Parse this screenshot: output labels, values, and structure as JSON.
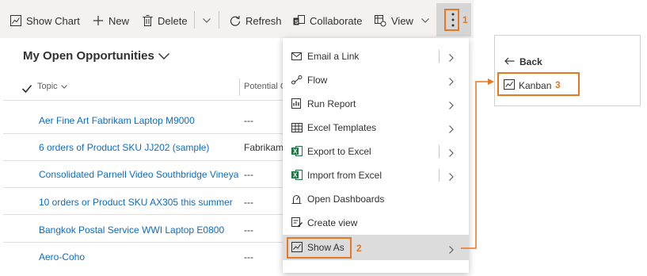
{
  "toolbar": {
    "show_chart": "Show Chart",
    "new": "New",
    "delete": "Delete",
    "refresh": "Refresh",
    "collaborate": "Collaborate",
    "view": "View",
    "more_icon": "more-vertical-icon"
  },
  "callouts": {
    "step1": "1",
    "step2": "2",
    "step3": "3"
  },
  "grid": {
    "view_title": "My Open Opportunities",
    "columns": {
      "topic": "Topic",
      "potential": "Potential C"
    },
    "rows": [
      {
        "topic": "Aer Fine Art Fabrikam Laptop M9000",
        "potential": "---"
      },
      {
        "topic": "6 orders of Product SKU JJ202 (sample)",
        "potential": "Fabrikam,"
      },
      {
        "topic": "Consolidated Parnell Video Southbridge Vineya",
        "potential": "---"
      },
      {
        "topic": "10 orders or Product SKU AX305 this summer",
        "potential": "---"
      },
      {
        "topic": "Bangkok Postal Service WWI Laptop E0800",
        "potential": "---"
      },
      {
        "topic": "Aero-Coho",
        "potential": "---"
      }
    ]
  },
  "menu": {
    "items": [
      {
        "label": "Email a Link",
        "icon": "email-link-icon"
      },
      {
        "label": "Flow",
        "icon": "flow-icon"
      },
      {
        "label": "Run Report",
        "icon": "report-icon"
      },
      {
        "label": "Excel Templates",
        "icon": "excel-templates-icon"
      },
      {
        "label": "Export to Excel",
        "icon": "excel-icon"
      },
      {
        "label": "Import from Excel",
        "icon": "excel-icon"
      },
      {
        "label": "Open Dashboards",
        "icon": "dashboard-icon"
      },
      {
        "label": "Create view",
        "icon": "create-view-icon"
      },
      {
        "label": "Show As",
        "icon": "chart-icon"
      }
    ]
  },
  "submenu": {
    "back": "Back",
    "kanban": "Kanban"
  },
  "colors": {
    "accent_orange": "#e87722",
    "link_blue": "#0f6cbd",
    "excel_green": "#217346"
  }
}
